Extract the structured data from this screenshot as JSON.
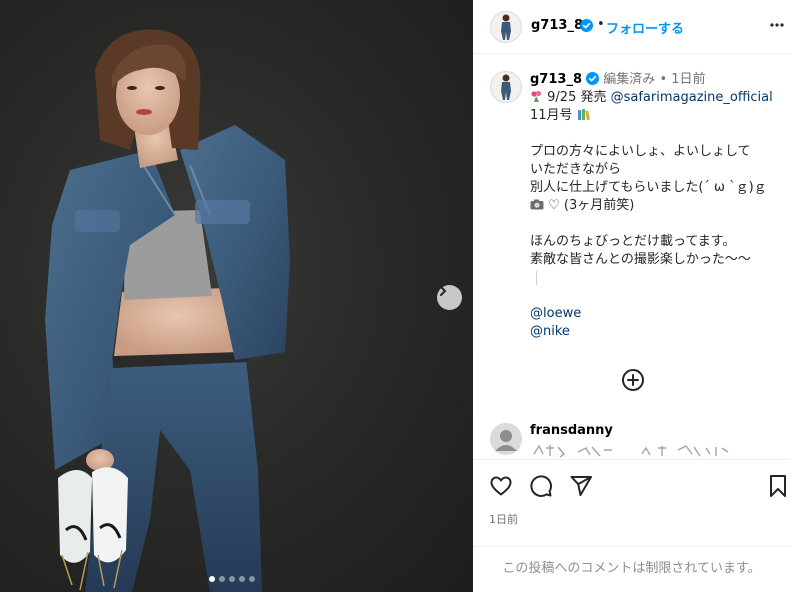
{
  "post": {
    "carousel": {
      "total": 5,
      "active": 0
    },
    "next_icon": "chevron-right-icon"
  },
  "header": {
    "username": "g713_8",
    "separator": "•",
    "follow_label": "フォローする",
    "more_icon": "more-horizontal-icon"
  },
  "caption": {
    "username": "g713_8",
    "edited": "編集済み",
    "dot": "•",
    "time": "1日前",
    "line1_date": "9/25 発売 ",
    "line1_mention": "@safarimagazine_official",
    "line2": "11月号",
    "para1": [
      "プロの方々によいしょ、よいしょして",
      "いただきながら",
      "別人に仕上げてもらいました(´ ω `ｇ)ｇ",
      "♡ (3ヶ月前笑)"
    ],
    "para2": [
      "ほんのちょびっとだけ載ってます。",
      "素敵な皆さんとの撮影楽しかった〜〜"
    ],
    "mentions": [
      "@loewe",
      "@nike"
    ],
    "load_more_icon": "plus-circle-icon"
  },
  "comment": {
    "username": "fransdanny"
  },
  "actions": {
    "like_icon": "heart-icon",
    "comment_icon": "comment-icon",
    "share_icon": "send-icon",
    "save_icon": "bookmark-icon",
    "time": "1日前"
  },
  "footer": {
    "restricted_text": "この投稿へのコメントは制限されています。"
  },
  "colors": {
    "accent": "#0095f6",
    "link": "#00376b",
    "muted": "#737373",
    "verified": "#0095f6"
  }
}
